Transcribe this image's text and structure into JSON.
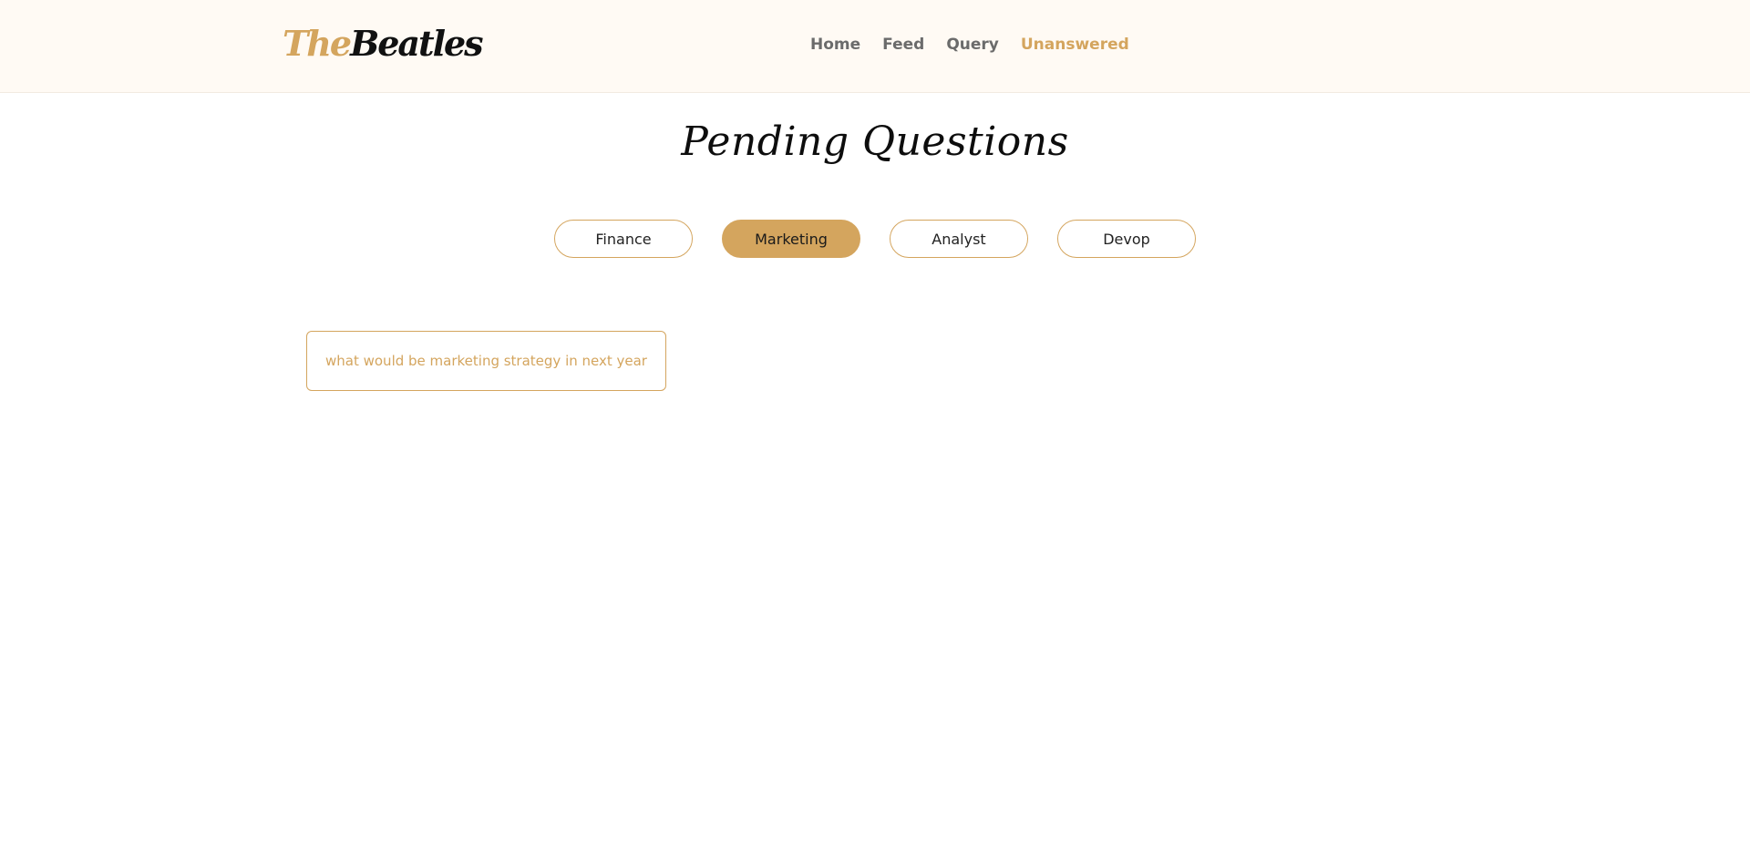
{
  "brand": {
    "prefix": "The",
    "name": "Beatles"
  },
  "nav": {
    "items": [
      {
        "label": "Home"
      },
      {
        "label": "Feed"
      },
      {
        "label": "Query"
      },
      {
        "label": "Unanswered",
        "active": true
      }
    ]
  },
  "page": {
    "title": "Pending Questions"
  },
  "tabs": {
    "items": [
      {
        "label": "Finance"
      },
      {
        "label": "Marketing",
        "selected": true
      },
      {
        "label": "Analyst"
      },
      {
        "label": "Devop"
      }
    ]
  },
  "questions": [
    {
      "text": "what would be marketing strategy in next year"
    }
  ],
  "colors": {
    "accent": "#d4a55e",
    "header_bg": "#fffaf4",
    "text_dark": "#111111",
    "nav_text": "#6b6b6b"
  }
}
